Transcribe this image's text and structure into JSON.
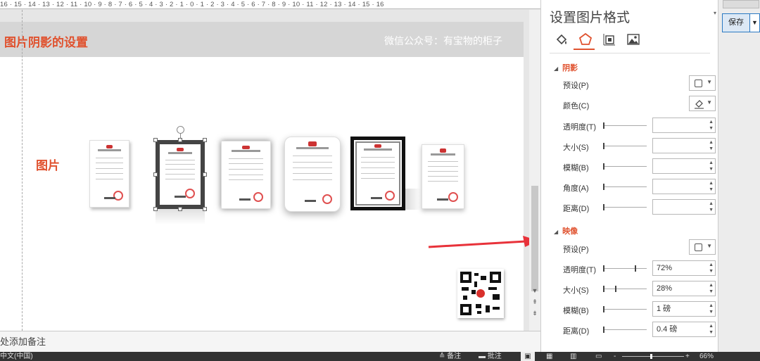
{
  "ruler": {
    "text": "16 · 15 · 14 · 13 · 12 · 11 · 10 · 9 · 8 · 7 · 6 · 5 · 4 · 3 · 2 · 1 · 0 · 1 · 2 · 3 · 4 · 5 · 6 · 7 · 8 · 9 · 10 · 11 · 12 · 13 · 14 · 15 · 16"
  },
  "slide": {
    "title": "图片阴影的设置",
    "subtitle": "微信公众号：有宝物的柜子",
    "picture_label": "图片"
  },
  "notes": {
    "placeholder": "处添加备注"
  },
  "statusbar": {
    "language": "中文(中国)",
    "notes_label": "备注",
    "comments_label": "批注",
    "zoom": "66%",
    "zoom_minus": "-",
    "zoom_plus": "+"
  },
  "pane": {
    "title": "设置图片格式",
    "tabs": [
      {
        "name": "fill-line",
        "icon": "paint-bucket-icon"
      },
      {
        "name": "effects",
        "icon": "pentagon-icon"
      },
      {
        "name": "size-properties",
        "icon": "size-icon"
      },
      {
        "name": "picture",
        "icon": "picture-icon"
      }
    ],
    "shadow": {
      "header": "阴影",
      "preset_label": "预设(P)",
      "color_label": "颜色(C)",
      "transparency_label": "透明度(T)",
      "size_label": "大小(S)",
      "blur_label": "模糊(B)",
      "angle_label": "角度(A)",
      "distance_label": "距离(D)",
      "transparency_value": "",
      "size_value": "",
      "blur_value": "",
      "angle_value": "",
      "distance_value": ""
    },
    "reflection": {
      "header": "映像",
      "preset_label": "预设(P)",
      "transparency_label": "透明度(T)",
      "size_label": "大小(S)",
      "blur_label": "模糊(B)",
      "distance_label": "距离(D)",
      "transparency_value": "72%",
      "size_value": "28%",
      "blur_value": "1 磅",
      "distance_value": "0.4 磅",
      "transparency_level": 0.72,
      "size_level": 0.28
    }
  },
  "right_strip": {
    "save_label": "保存"
  },
  "colors": {
    "accent": "#e0522f",
    "title_bar": "#d6d6d6",
    "arrow": "#e8323a",
    "button_border": "#2b79c2"
  }
}
